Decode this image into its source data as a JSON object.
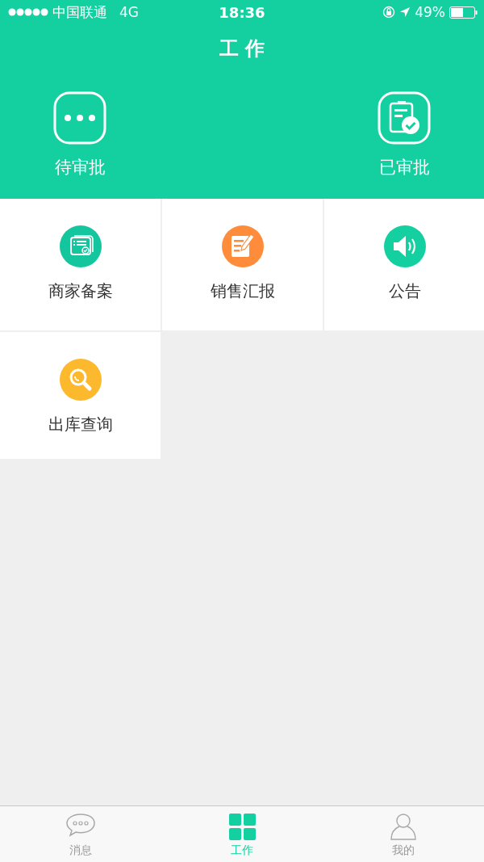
{
  "status_bar": {
    "carrier": "中国联通",
    "network": "4G",
    "time": "18:36",
    "battery": "49%"
  },
  "title": "工 作",
  "approvals": [
    {
      "kind": "pending",
      "label": "待审批"
    },
    {
      "kind": "approved",
      "label": "已审批"
    }
  ],
  "grid": [
    {
      "kind": "merchant",
      "label": "商家备案",
      "color": "#13c69e"
    },
    {
      "kind": "report",
      "label": "销售汇报",
      "color": "#fe8c3a"
    },
    {
      "kind": "notice",
      "label": "公告",
      "color": "#14cf9f"
    },
    {
      "kind": "search",
      "label": "出库查询",
      "color": "#fdb92e"
    }
  ],
  "tab_bar": [
    {
      "kind": "messages",
      "label": "消息",
      "selected": false
    },
    {
      "kind": "work",
      "label": "工作",
      "selected": true
    },
    {
      "kind": "me",
      "label": "我的",
      "selected": false
    }
  ]
}
